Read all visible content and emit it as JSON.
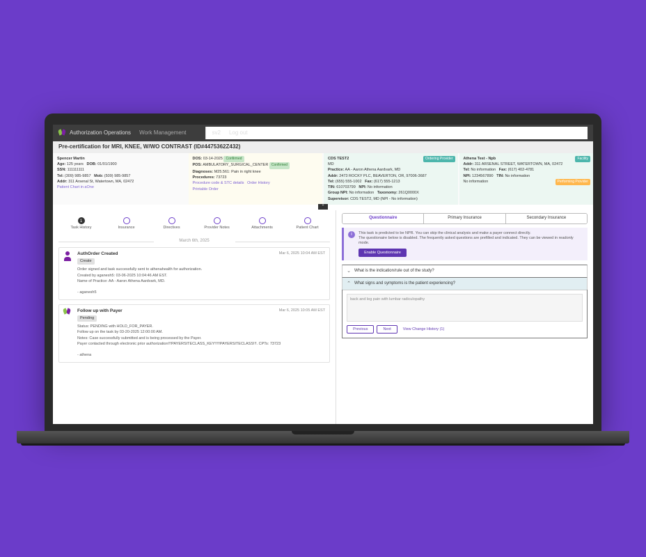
{
  "topbar": {
    "title": "Authorization Operations",
    "nav": "Work Management",
    "user": "sv2",
    "logout": "Log out"
  },
  "hdr": "Pre-certification for MRI, KNEE, W/WO CONTRAST (ID#4475362Z432)",
  "p1": {
    "name": "Spencer Martin",
    "age_l": "Age:",
    "age": "125 years",
    "dob_l": "DOB:",
    "dob": "01/01/1900",
    "ssn_l": "SSN:",
    "ssn": "111111111",
    "tel_l": "Tel:",
    "tel": "(309) 985-9857",
    "mob_l": "Mob:",
    "mob": "(509) 985-9857",
    "addr_l": "Addr:",
    "addr": "311 Arsenal St, Watertown, MA, 02472",
    "link": "Patient Chart in aOne"
  },
  "p2": {
    "dos_l": "DOS:",
    "dos": "03-14-2025",
    "conf": "Confirmed",
    "pos_l": "POS:",
    "pos": "AMBULATORY_SURGICAL_CENTER",
    "diag_l": "Diagnoses:",
    "diag": "M25.561: Pain in right knee",
    "proc_l": "Procedures:",
    "proc": "73723",
    "lnk1": "Procedure code & STC details",
    "lnk2": "Order History",
    "lnk3": "Printable Order"
  },
  "p3": {
    "title": "CDS TEST2",
    "badge": "Ordering Provider",
    "md": "MD",
    "prac_l": "Practice:",
    "prac": "AA - Aaron Athena Aardvark, MD",
    "addr_l": "Addr:",
    "addr": "2473 ROCKY PLC, BEAVERTON, OR, 97006-3687",
    "tel_l": "Tel:",
    "tel": "(655) 555-1002",
    "fax_l": "Fax:",
    "fax": "(617) 555-1213",
    "tin_l": "TIN:",
    "tin": "610703799",
    "npi_l": "NPI:",
    "npi": "No information",
    "gnpi_l": "Group NPI:",
    "gnpi": "No information",
    "tax_l": "Taxonomy:",
    "tax": "261Q0000X",
    "sup_l": "Supervisor:",
    "sup": "CDS TEST2, MD (NPI - No information)"
  },
  "p4": {
    "title": "Athena Test - Npb",
    "badge": "Facility",
    "addr_l": "Addr:",
    "addr": "311 ARSENAL STREET, WATERTOWN, MA, 02472",
    "tel_l": "Tel:",
    "tel": "No information",
    "fax_l": "Fax:",
    "fax": "(617) 402-4781",
    "npi_l": "NPI:",
    "npi": "1234567890",
    "tin_l": "TIN:",
    "tin": "No information",
    "noinfo": "No information",
    "badge2": "Performing Provider"
  },
  "steps": [
    "Task History",
    "Insurance",
    "Directives",
    "Provider Notes",
    "Attachments",
    "Patient Chart"
  ],
  "date": "March 6th, 2025",
  "c1": {
    "title": "AuthOrder Created",
    "time": "Mar 6, 2025 10:04 AM EST",
    "tag": "Create",
    "l1": "Order signed and task successfully sent to athenahealth for authorization.",
    "l2": "Created by aganesh5: 03-06-2025 10:04:46 AM EST.",
    "l3": "Name of Practice: AA - Aaron Athena Aardvark, MD.",
    "l4": "- aganesh5"
  },
  "c2": {
    "title": "Follow up with Payer",
    "time": "Mar 6, 2025 10:05 AM EST",
    "tag": "Pending",
    "l1": "Status: PENDING with HOLD_FOR_PAYER.",
    "l2": "Follow up on the task by 03-20-2025 12:00:00 AM.",
    "l3": "Notes: Case successfully submitted and is being processed by the Payer.",
    "l4": "Payer contacted through electronic prior authorization!!!PAYERSITECLASS_KEY!!!!!PAYERSITECLASS!!!. CPTs: 73723",
    "l5": "- athena"
  },
  "tabs": [
    "Questionnaire",
    "Primary Insurance",
    "Secondary Insurance"
  ],
  "alert": {
    "l1": "This task is predicted to be NPR. You can skip the clinical analysis and make a payer connect directly.",
    "l2": "The questionaire below is disabled. The frequently asked questions are prefilled and indicated. They can be viewed in readonly mode.",
    "btn": "Enable Questionnaire"
  },
  "q1": "What is the indication/rule out of the study?",
  "q2": "What signs and symptoms is the patient experiencing?",
  "qtext": "back and leg pain with lumbar radiculopathy",
  "btns": {
    "prev": "Previous",
    "next": "Next",
    "hist": "View Change History (1)"
  }
}
